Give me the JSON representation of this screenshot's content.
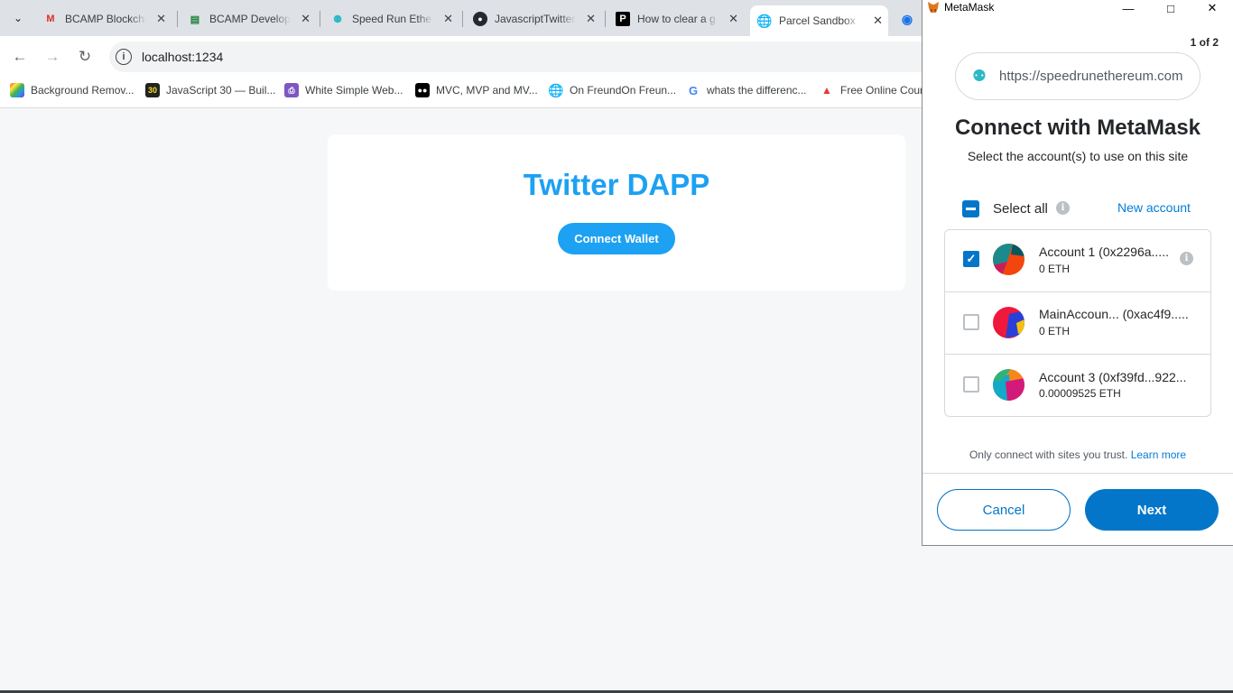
{
  "browser": {
    "tabs": [
      {
        "title": "BCAMP Blockcha",
        "icon": "gmail-icon"
      },
      {
        "title": "BCAMP Develop",
        "icon": "sheets-icon"
      },
      {
        "title": "Speed Run Ethe",
        "icon": "speedrun-icon"
      },
      {
        "title": "JavascriptTwitter",
        "icon": "github-icon"
      },
      {
        "title": "How to clear a g",
        "icon": "pexels-icon"
      },
      {
        "title": "Parcel Sandbox",
        "icon": "globe-icon",
        "active": true
      }
    ],
    "url": "localhost:1234",
    "bookmarks": [
      {
        "label": "Background Remov..."
      },
      {
        "label": "JavaScript 30 — Buil..."
      },
      {
        "label": "White Simple Web..."
      },
      {
        "label": "MVC, MVP and MV..."
      },
      {
        "label": "On FreundOn Freun..."
      },
      {
        "label": "whats the differenc..."
      },
      {
        "label": "Free Online Cour"
      }
    ]
  },
  "page": {
    "title": "Twitter DAPP",
    "connect_button": "Connect Wallet"
  },
  "metamask": {
    "window_title": "MetaMask",
    "pager": "1 of 2",
    "origin": "https://speedrunethereum.com",
    "heading": "Connect with MetaMask",
    "subheading": "Select the account(s) to use on this site",
    "select_all": "Select all",
    "new_account": "New account",
    "accounts": [
      {
        "name": "Account 1 (0x2296a.....",
        "balance": "0 ETH",
        "checked": true
      },
      {
        "name": "MainAccoun... (0xac4f9.....",
        "balance": "0 ETH",
        "checked": false
      },
      {
        "name": "Account 3 (0xf39fd...922...",
        "balance": "0.00009525 ETH",
        "checked": false
      }
    ],
    "trust_text": "Only connect with sites you trust.",
    "learn_more": "Learn more",
    "cancel": "Cancel",
    "next": "Next"
  },
  "colors": {
    "twitter_blue": "#1da1f2",
    "metamask_blue": "#0376c9"
  }
}
